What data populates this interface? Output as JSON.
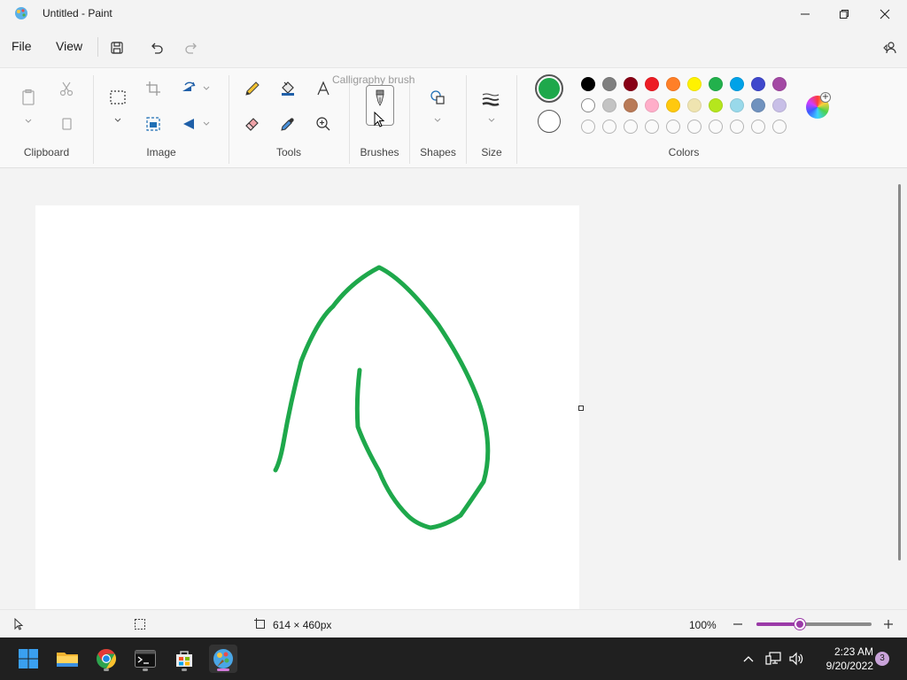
{
  "window": {
    "title": "Untitled - Paint",
    "buttons": [
      "minimize-icon",
      "restore-icon",
      "close-icon"
    ]
  },
  "menu": {
    "file": "File",
    "view": "View",
    "quick_actions": [
      "save-icon",
      "undo-icon",
      "redo-icon"
    ],
    "share_icon": "share-icon"
  },
  "ribbon": {
    "groups": {
      "clipboard": "Clipboard",
      "image": "Image",
      "tools": "Tools",
      "brushes": "Brushes",
      "shapes": "Shapes",
      "size": "Size",
      "colors": "Colors"
    },
    "tooltip": "Calligraphy brush",
    "primary_color": "#1ea84b",
    "secondary_color": "#ffffff",
    "palette_row1": [
      "#000000",
      "#7f7f7f",
      "#880015",
      "#ed1c24",
      "#ff7f27",
      "#fff200",
      "#22b14c",
      "#00a2e8",
      "#3f48cc",
      "#a349a4"
    ],
    "palette_row2": [
      "#ffffff",
      "#c3c3c3",
      "#b97a57",
      "#ffaec9",
      "#ffc90e",
      "#efe4b0",
      "#b5e61d",
      "#99d9ea",
      "#7092be",
      "#c8bfe7"
    ],
    "palette_row3": [
      "empty",
      "empty",
      "empty",
      "empty",
      "empty",
      "empty",
      "empty",
      "empty",
      "empty",
      "empty"
    ]
  },
  "canvas": {
    "stroke_color": "#1ea84b"
  },
  "status": {
    "dimensions": "614 × 460px",
    "zoom": "100%",
    "zoom_level": 0.38
  },
  "taskbar": {
    "apps": [
      "start-icon",
      "file-explorer-icon",
      "chrome-icon",
      "terminal-icon",
      "store-icon",
      "paint-icon"
    ],
    "time": "2:23 AM",
    "date": "9/20/2022",
    "notifications": "3"
  }
}
